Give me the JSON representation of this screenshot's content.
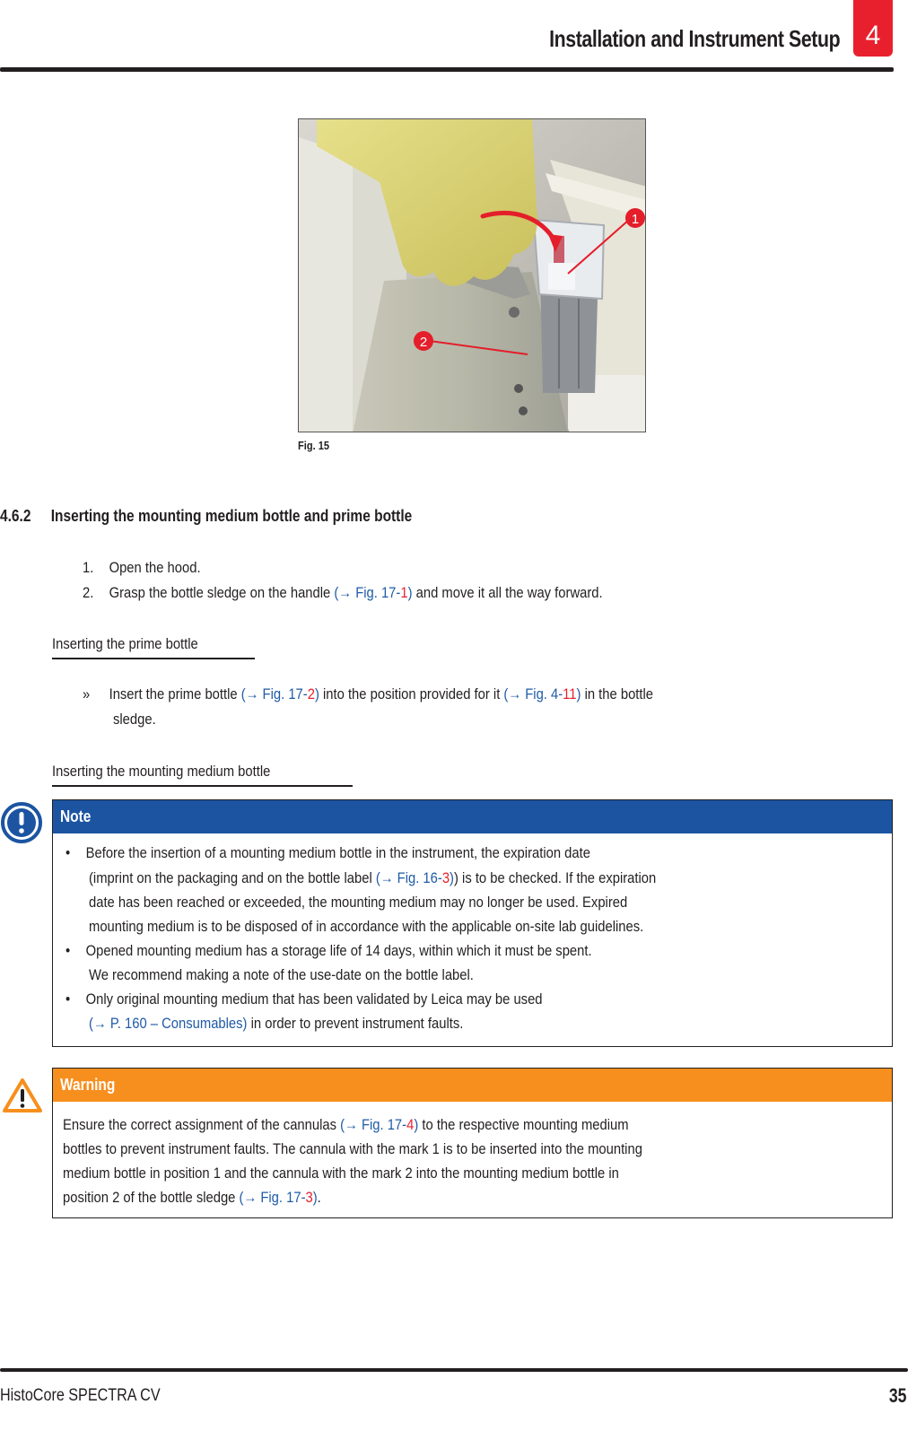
{
  "header": {
    "title": "Installation and Instrument Setup",
    "chapter": "4"
  },
  "figure": {
    "caption": "Fig.  15",
    "callouts": [
      "1",
      "2"
    ]
  },
  "section": {
    "number": "4.6.2",
    "title": "Inserting the mounting medium bottle and prime bottle",
    "steps": [
      {
        "n": "1.",
        "text": "Open the hood."
      },
      {
        "n": "2.",
        "before": "Grasp the bottle sledge on the handle ",
        "link": "(→ Fig.  17-",
        "ref": "1",
        "link_close": ")",
        "after": " and move it all the way forward."
      }
    ]
  },
  "prime": {
    "heading": "Inserting the prime bottle",
    "mark": "»",
    "line1_before": "Insert the prime bottle ",
    "link1": "(→ Fig.  17-",
    "ref1": "2",
    "link1_close": ")",
    "line1_mid": " into the position provided for it ",
    "link2": "(→ Fig.  4-",
    "ref2": "11",
    "link2_close": ")",
    "line1_after": " in the bottle",
    "line2": "sledge."
  },
  "mounting": {
    "heading": "Inserting the mounting medium bottle"
  },
  "note": {
    "title": "Note",
    "bullet": "•",
    "b1_l1": "Before the insertion of a mounting medium bottle in the instrument, the expiration date",
    "b1_l2_before": "(imprint on the packaging and on the bottle label ",
    "b1_l2_link": "(→ Fig.  16-",
    "b1_l2_ref": "3",
    "b1_l2_link_close": ")",
    "b1_l2_after": ") is to be checked. If the expiration",
    "b1_l3": "date has been reached or exceeded, the mounting medium may no longer be used. Expired",
    "b1_l4": "mounting medium is to be disposed of in accordance with the applicable on-site lab guidelines.",
    "b2_l1": "Opened mounting medium has a storage life of 14 days, within which it must be spent.",
    "b2_l2": "We recommend making a note of the use-date on the bottle label.",
    "b3_l1": "Only original mounting medium that has been validated by Leica may be used",
    "b3_l2_link": "(→ P. 160 – Consumables)",
    "b3_l2_after": " in order to prevent instrument faults."
  },
  "warning": {
    "title": "Warning",
    "l1_before": "Ensure the correct assignment of the cannulas ",
    "l1_link": "(→ Fig.  17-",
    "l1_ref": "4",
    "l1_link_close": ")",
    "l1_after": " to the respective mounting medium",
    "l2": "bottles to prevent instrument faults. The cannula with the mark 1 is to be inserted into the mounting",
    "l3": "medium bottle in position 1 and the cannula with the mark 2 into the mounting medium bottle in",
    "l4_before": "position 2 of the bottle sledge ",
    "l4_link": "(→ Fig.  17-",
    "l4_ref": "3",
    "l4_link_close": ")",
    "l4_after": "."
  },
  "footer": {
    "product": "HistoCore SPECTRA CV",
    "page": "35"
  },
  "colors": {
    "note_blue": "#1c54a2",
    "warning_orange": "#f78f1e",
    "chapter_red": "#e8202e",
    "link_blue": "#1f5aa6"
  }
}
